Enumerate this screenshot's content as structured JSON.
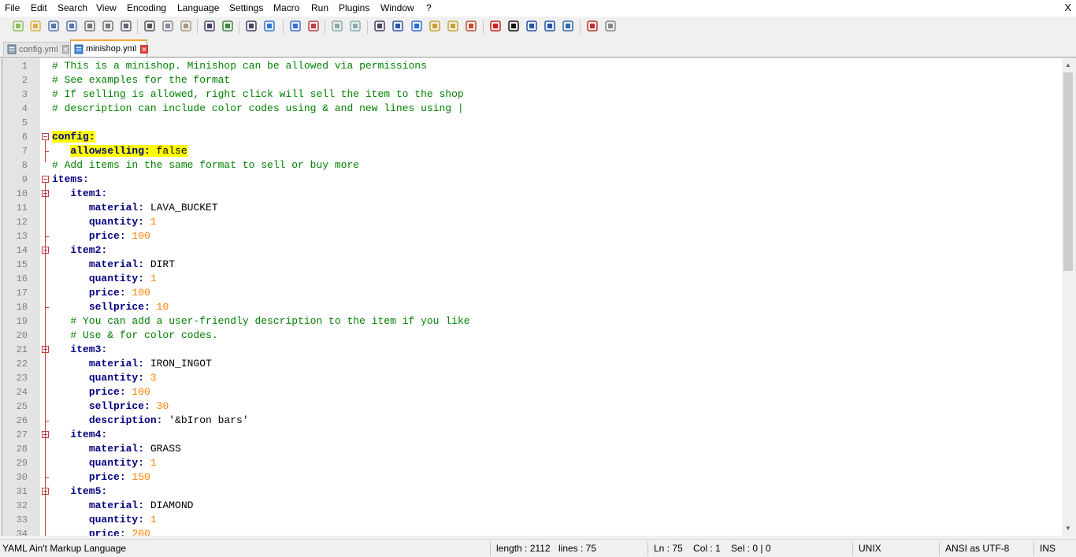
{
  "menu": [
    "File",
    "Edit",
    "Search",
    "View",
    "Encoding",
    "Language",
    "Settings",
    "Macro",
    "Run",
    "Plugins",
    "Window",
    "?"
  ],
  "close_glyph": "X",
  "toolbar_icons": [
    "new-file-icon",
    "open-file-icon",
    "save-icon",
    "save-all-icon",
    "close-icon",
    "close-all-icon",
    "print-icon",
    "cut-icon",
    "copy-icon",
    "paste-icon",
    "undo-icon",
    "redo-icon",
    "find-icon",
    "replace-icon",
    "zoom-in-icon",
    "zoom-out-icon",
    "sync-vertical-icon",
    "sync-horizontal-icon",
    "word-wrap-icon",
    "show-all-chars-icon",
    "indent-guide-icon",
    "doc-map-icon",
    "function-list-icon",
    "folder-workspace-icon",
    "record-macro-icon",
    "stop-macro-icon",
    "play-macro-icon",
    "run-macro-multiple-icon",
    "save-macro-icon",
    "spell-check-icon",
    "launch-icon"
  ],
  "tabs": [
    {
      "label": "config.yml",
      "active": false
    },
    {
      "label": "minishop.yml",
      "active": true
    }
  ],
  "tab_close_glyph": "✕",
  "colors": {
    "comment": "#008000",
    "key": "#000080",
    "number": "#ff8000",
    "highlight": "#ffff00"
  },
  "lines": [
    {
      "n": "1",
      "indent": "",
      "parts": [
        {
          "t": "# This is a minishop. Minishop can be allowed via permissions",
          "c": "comment"
        }
      ]
    },
    {
      "n": "2",
      "indent": "",
      "parts": [
        {
          "t": "# See examples for the format",
          "c": "comment"
        }
      ]
    },
    {
      "n": "3",
      "indent": "",
      "parts": [
        {
          "t": "# If selling is allowed, right click will sell the item to the shop",
          "c": "comment"
        }
      ]
    },
    {
      "n": "4",
      "indent": "",
      "parts": [
        {
          "t": "# description can include color codes using & and new lines using |",
          "c": "comment"
        }
      ]
    },
    {
      "n": "5",
      "indent": "",
      "parts": []
    },
    {
      "n": "6",
      "indent": "",
      "parts": [
        {
          "t": "config:",
          "c": "key",
          "hl": true
        }
      ]
    },
    {
      "n": "7",
      "indent": "   ",
      "parts": [
        {
          "t": "allowselling: ",
          "c": "key",
          "hl": true
        },
        {
          "t": "false",
          "c": "plain",
          "hl": true
        }
      ]
    },
    {
      "n": "8",
      "indent": "",
      "parts": [
        {
          "t": "# Add items in the same format to sell or buy more",
          "c": "comment"
        }
      ]
    },
    {
      "n": "9",
      "indent": "",
      "parts": [
        {
          "t": "items:",
          "c": "key"
        }
      ]
    },
    {
      "n": "10",
      "indent": "   ",
      "parts": [
        {
          "t": "item1:",
          "c": "key"
        }
      ]
    },
    {
      "n": "11",
      "indent": "      ",
      "parts": [
        {
          "t": "material: ",
          "c": "key"
        },
        {
          "t": "LAVA_BUCKET",
          "c": "plain"
        }
      ]
    },
    {
      "n": "12",
      "indent": "      ",
      "parts": [
        {
          "t": "quantity: ",
          "c": "key"
        },
        {
          "t": "1",
          "c": "num"
        }
      ]
    },
    {
      "n": "13",
      "indent": "      ",
      "parts": [
        {
          "t": "price: ",
          "c": "key"
        },
        {
          "t": "100",
          "c": "num"
        }
      ]
    },
    {
      "n": "14",
      "indent": "   ",
      "parts": [
        {
          "t": "item2:",
          "c": "key"
        }
      ]
    },
    {
      "n": "15",
      "indent": "      ",
      "parts": [
        {
          "t": "material: ",
          "c": "key"
        },
        {
          "t": "DIRT",
          "c": "plain"
        }
      ]
    },
    {
      "n": "16",
      "indent": "      ",
      "parts": [
        {
          "t": "quantity: ",
          "c": "key"
        },
        {
          "t": "1",
          "c": "num"
        }
      ]
    },
    {
      "n": "17",
      "indent": "      ",
      "parts": [
        {
          "t": "price: ",
          "c": "key"
        },
        {
          "t": "100",
          "c": "num"
        }
      ]
    },
    {
      "n": "18",
      "indent": "      ",
      "parts": [
        {
          "t": "sellprice: ",
          "c": "key"
        },
        {
          "t": "10",
          "c": "num"
        }
      ]
    },
    {
      "n": "19",
      "indent": "   ",
      "parts": [
        {
          "t": "# You can add a user-friendly description to the item if you like",
          "c": "comment"
        }
      ]
    },
    {
      "n": "20",
      "indent": "   ",
      "parts": [
        {
          "t": "# Use & for color codes.",
          "c": "comment"
        }
      ]
    },
    {
      "n": "21",
      "indent": "   ",
      "parts": [
        {
          "t": "item3:",
          "c": "key"
        }
      ]
    },
    {
      "n": "22",
      "indent": "      ",
      "parts": [
        {
          "t": "material: ",
          "c": "key"
        },
        {
          "t": "IRON_INGOT",
          "c": "plain"
        }
      ]
    },
    {
      "n": "23",
      "indent": "      ",
      "parts": [
        {
          "t": "quantity: ",
          "c": "key"
        },
        {
          "t": "3",
          "c": "num"
        }
      ]
    },
    {
      "n": "24",
      "indent": "      ",
      "parts": [
        {
          "t": "price: ",
          "c": "key"
        },
        {
          "t": "100",
          "c": "num"
        }
      ]
    },
    {
      "n": "25",
      "indent": "      ",
      "parts": [
        {
          "t": "sellprice: ",
          "c": "key"
        },
        {
          "t": "30",
          "c": "num"
        }
      ]
    },
    {
      "n": "26",
      "indent": "      ",
      "parts": [
        {
          "t": "description: ",
          "c": "key"
        },
        {
          "t": "'&bIron bars'",
          "c": "plain"
        }
      ]
    },
    {
      "n": "27",
      "indent": "   ",
      "parts": [
        {
          "t": "item4:",
          "c": "key"
        }
      ]
    },
    {
      "n": "28",
      "indent": "      ",
      "parts": [
        {
          "t": "material: ",
          "c": "key"
        },
        {
          "t": "GRASS",
          "c": "plain"
        }
      ]
    },
    {
      "n": "29",
      "indent": "      ",
      "parts": [
        {
          "t": "quantity: ",
          "c": "key"
        },
        {
          "t": "1",
          "c": "num"
        }
      ]
    },
    {
      "n": "30",
      "indent": "      ",
      "parts": [
        {
          "t": "price: ",
          "c": "key"
        },
        {
          "t": "150",
          "c": "num"
        }
      ]
    },
    {
      "n": "31",
      "indent": "   ",
      "parts": [
        {
          "t": "item5:",
          "c": "key"
        }
      ]
    },
    {
      "n": "32",
      "indent": "      ",
      "parts": [
        {
          "t": "material: ",
          "c": "key"
        },
        {
          "t": "DIAMOND",
          "c": "plain"
        }
      ]
    },
    {
      "n": "33",
      "indent": "      ",
      "parts": [
        {
          "t": "quantity: ",
          "c": "key"
        },
        {
          "t": "1",
          "c": "num"
        }
      ]
    },
    {
      "n": "34",
      "indent": "      ",
      "parts": [
        {
          "t": "price: ",
          "c": "key"
        },
        {
          "t": "200",
          "c": "num"
        }
      ]
    }
  ],
  "status": {
    "language": "YAML Ain't Markup Language",
    "length": "length : 2112",
    "lines": "lines : 75",
    "position": "Ln : 75    Col : 1    Sel : 0 | 0",
    "eol": "UNIX",
    "encoding": "ANSI as UTF-8",
    "mode": "INS"
  }
}
